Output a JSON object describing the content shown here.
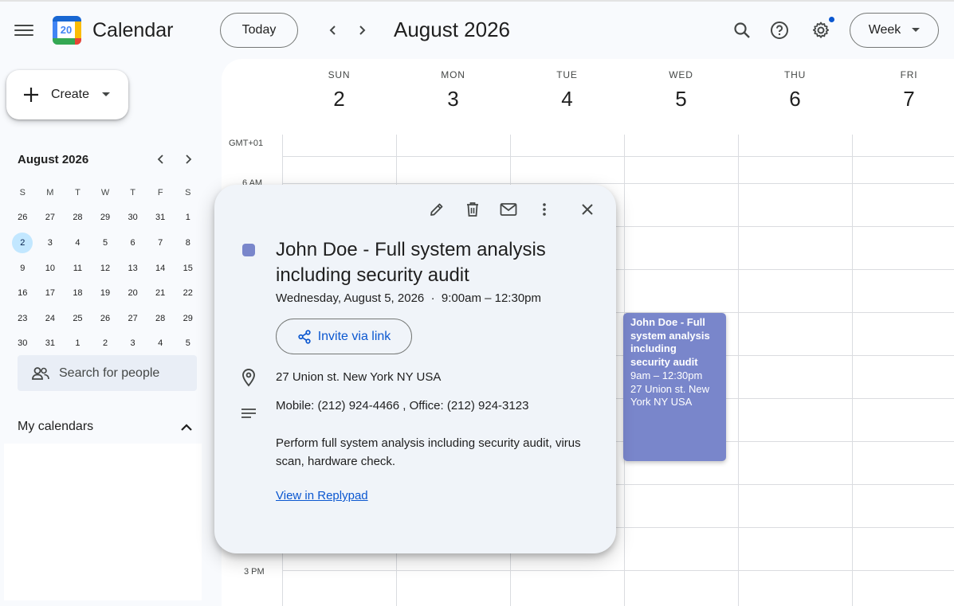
{
  "header": {
    "app_title": "Calendar",
    "logo_day": "20",
    "today_label": "Today",
    "current_period": "August 2026",
    "view_label": "Week",
    "icons": [
      "menu-icon",
      "prev-icon",
      "next-icon",
      "search-icon",
      "help-icon",
      "settings-icon",
      "dropdown-icon"
    ]
  },
  "sidebar": {
    "create_label": "Create",
    "mini_calendar": {
      "title": "August 2026",
      "weekdays": [
        "S",
        "M",
        "T",
        "W",
        "T",
        "F",
        "S"
      ],
      "weeks": [
        [
          "26",
          "27",
          "28",
          "29",
          "30",
          "31",
          "1"
        ],
        [
          "2",
          "3",
          "4",
          "5",
          "6",
          "7",
          "8"
        ],
        [
          "9",
          "10",
          "11",
          "12",
          "13",
          "14",
          "15"
        ],
        [
          "16",
          "17",
          "18",
          "19",
          "20",
          "21",
          "22"
        ],
        [
          "23",
          "24",
          "25",
          "26",
          "27",
          "28",
          "29"
        ],
        [
          "30",
          "31",
          "1",
          "2",
          "3",
          "4",
          "5"
        ]
      ],
      "selected": "2"
    },
    "search_people_placeholder": "Search for people",
    "my_calendars_label": "My calendars"
  },
  "week": {
    "timezone": "GMT+01",
    "days": [
      {
        "dow": "SUN",
        "num": "2"
      },
      {
        "dow": "MON",
        "num": "3"
      },
      {
        "dow": "TUE",
        "num": "4"
      },
      {
        "dow": "WED",
        "num": "5"
      },
      {
        "dow": "THU",
        "num": "6"
      },
      {
        "dow": "FRI",
        "num": "7"
      }
    ],
    "time_labels": {
      "first": "6 AM",
      "last": "3 PM"
    }
  },
  "event": {
    "title": "John Doe - Full system analysis including security audit",
    "time": "9am – 12:30pm",
    "location": "27 Union st. New York NY USA",
    "color": "#7986cb"
  },
  "popup": {
    "title": "John Doe - Full system analysis including security audit",
    "when": "Wednesday, August 5, 2026  ·  9:00am – 12:30pm",
    "invite_label": "Invite via link",
    "location": "27 Union st. New York NY USA",
    "phone": "Mobile: (212) 924-4466 , Office: (212) 924-3123",
    "description": "Perform full system analysis including security audit, virus scan, hardware check.",
    "link_label": "View in Replypad",
    "actions": [
      "edit-icon",
      "delete-icon",
      "email-icon",
      "more-icon",
      "close-icon"
    ]
  },
  "colors": {
    "accent": "#0b57d0",
    "selected_day": "#c2e7ff",
    "event": "#7986cb"
  }
}
